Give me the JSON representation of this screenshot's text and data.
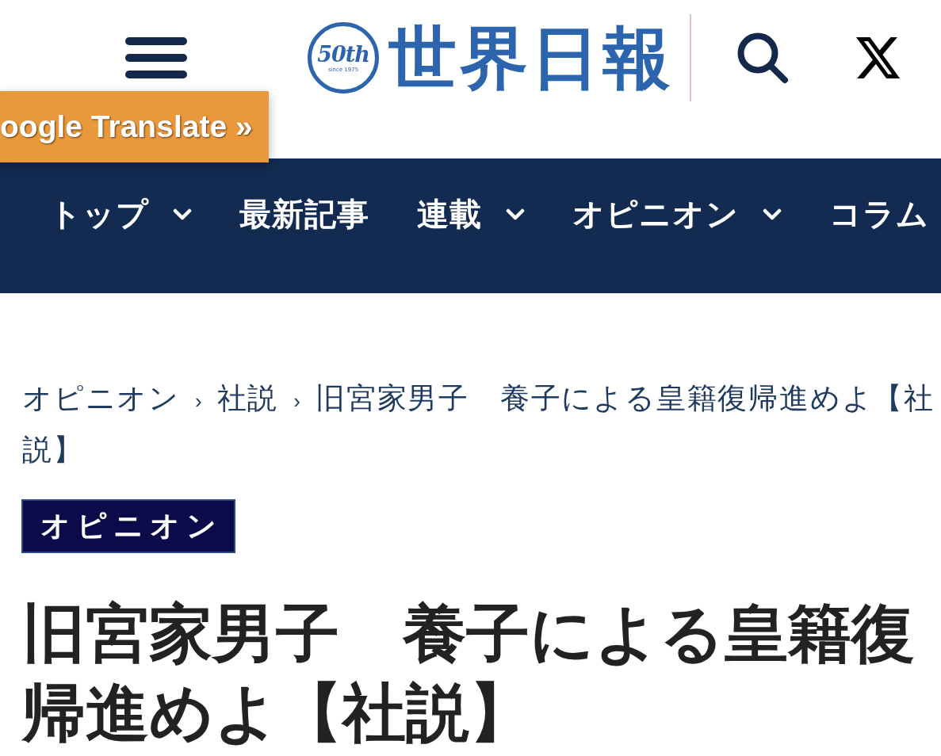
{
  "header": {
    "logo": {
      "badge_number": "50th",
      "badge_caption": "since 1975",
      "wordmark": "世界日報"
    }
  },
  "translate_button": {
    "label": "oogle Translate »"
  },
  "nav": {
    "items": [
      {
        "label": "トップ",
        "has_dropdown": true
      },
      {
        "label": "最新記事",
        "has_dropdown": false
      },
      {
        "label": "連載",
        "has_dropdown": true
      },
      {
        "label": "オピニオン",
        "has_dropdown": true
      },
      {
        "label": "コラム",
        "has_dropdown": false
      }
    ]
  },
  "breadcrumb": {
    "items": [
      {
        "kind": "link",
        "label": "オピニオン"
      },
      {
        "kind": "separator",
        "label": "›"
      },
      {
        "kind": "link",
        "label": "社説"
      },
      {
        "kind": "separator",
        "label": "›"
      },
      {
        "kind": "current",
        "label": "旧宮家男子　養子による皇籍復帰進めよ【社説】"
      }
    ]
  },
  "category_badge": {
    "label": "オピニオン"
  },
  "article": {
    "title": "旧宮家男子　養子による皇籍復帰進めよ【社説】"
  }
}
